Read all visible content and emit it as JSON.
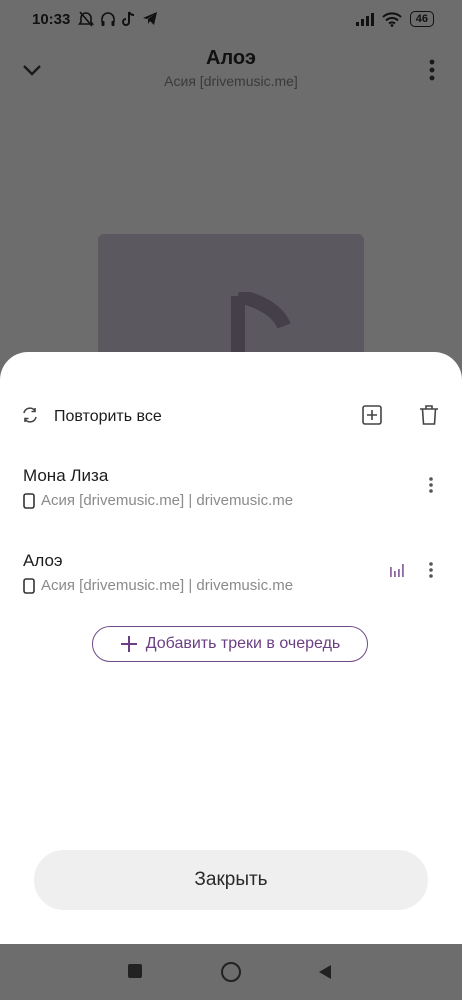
{
  "status_bar": {
    "time": "10:33",
    "battery": "46"
  },
  "player": {
    "title": "Алоэ",
    "subtitle": "Асия [drivemusic.me]"
  },
  "queue": {
    "repeat_label": "Повторить все",
    "tracks": [
      {
        "title": "Мона Лиза",
        "meta": "Асия [drivemusic.me] | drivemusic.me",
        "playing": false
      },
      {
        "title": "Алоэ",
        "meta": "Асия [drivemusic.me] | drivemusic.me",
        "playing": true
      }
    ],
    "add_tracks_label": "Добавить треки в очередь",
    "close_label": "Закрыть"
  },
  "colors": {
    "accent": "#6a3f83",
    "scrim": "#6d6d6d",
    "sheet": "#ffffff"
  },
  "icons": [
    "repeat-icon",
    "add-to-playlist-icon",
    "trash-icon",
    "phone-storage-icon",
    "equalizer-icon",
    "more-vert-icon",
    "plus-icon",
    "chevron-down-icon",
    "music-note-icon"
  ]
}
